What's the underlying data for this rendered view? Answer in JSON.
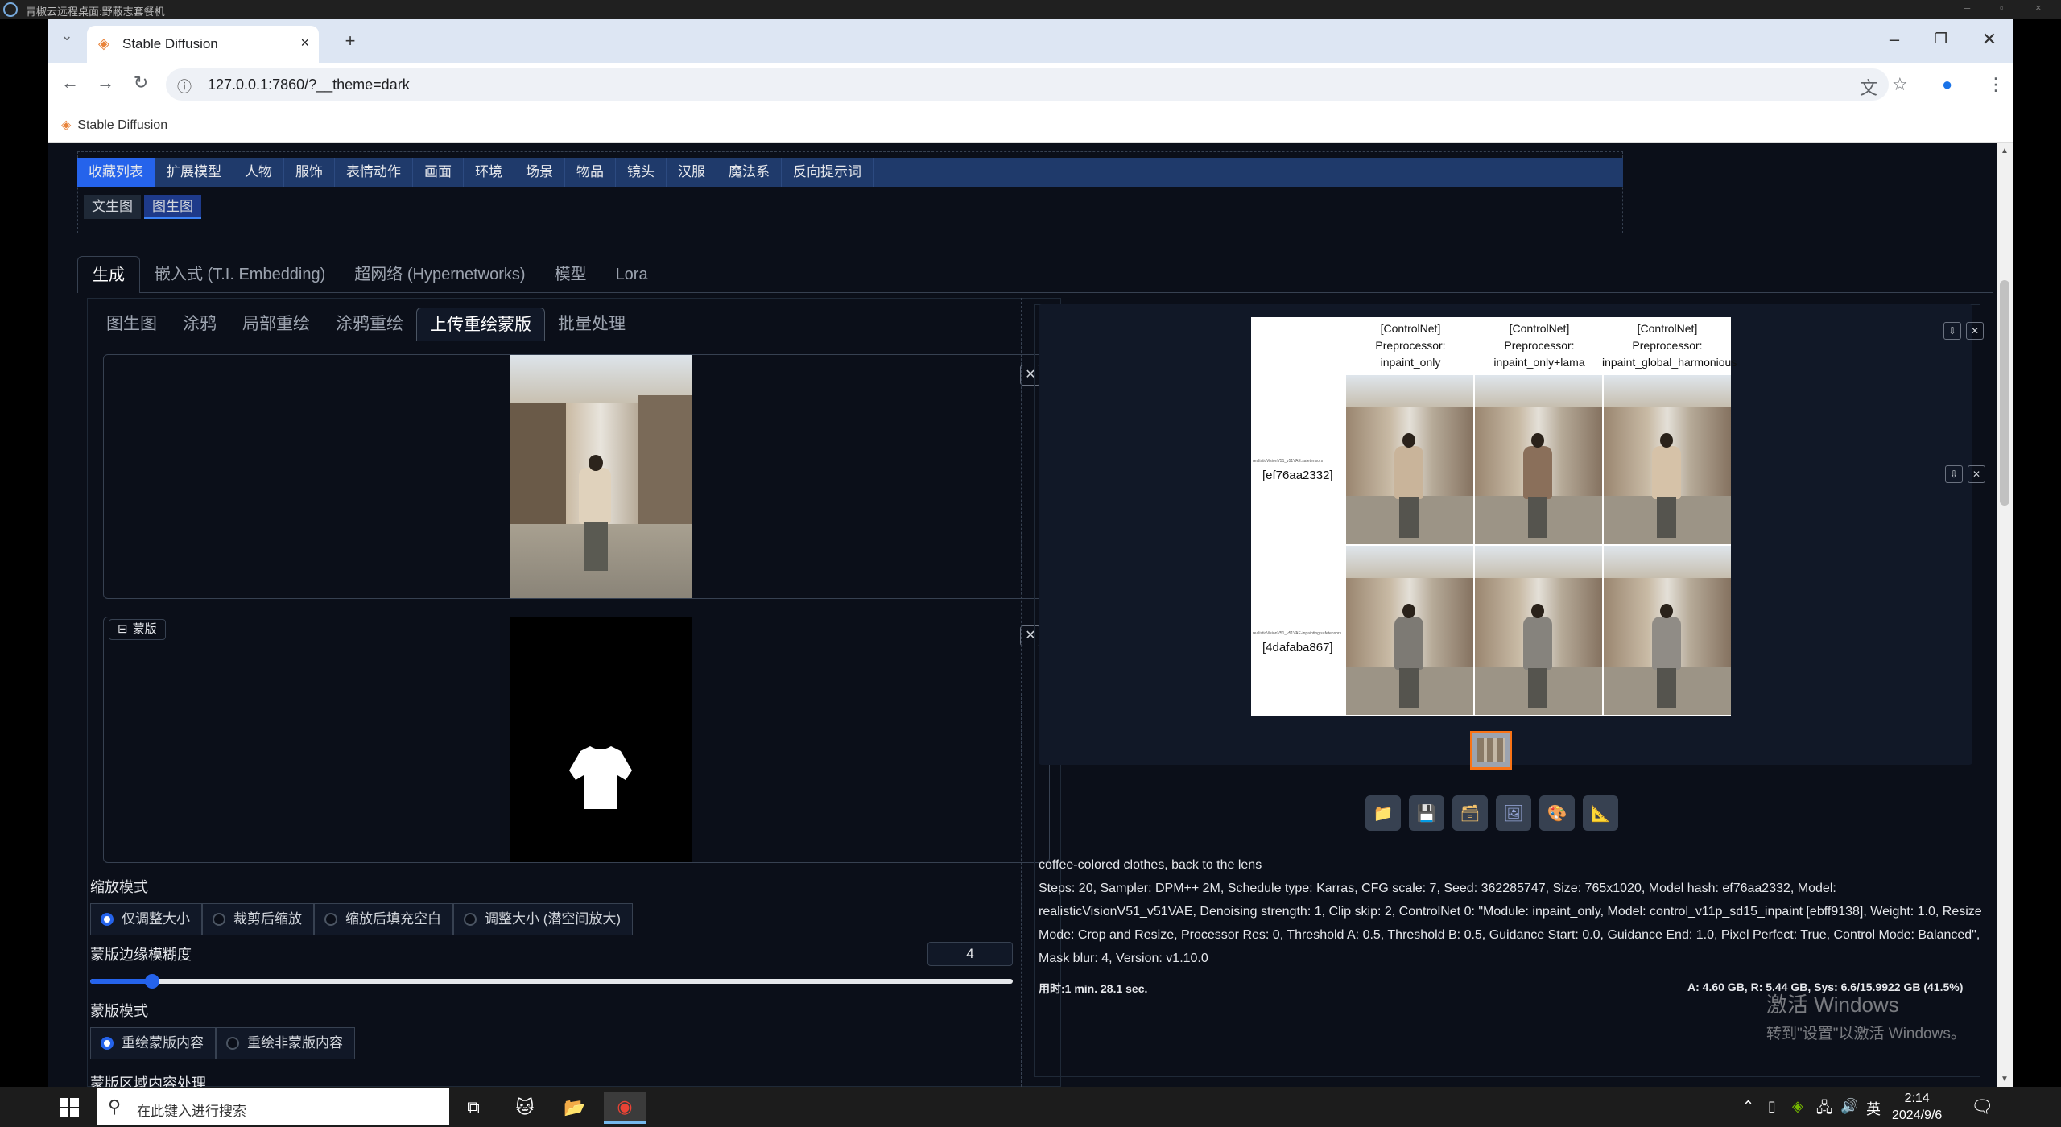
{
  "remote_desktop": {
    "title": "青椒云远程桌面:野蔽志套餐机"
  },
  "browser": {
    "tab_title": "Stable Diffusion",
    "url": "127.0.0.1:7860/?__theme=dark",
    "bookmark": "Stable Diffusion",
    "new_tab": "+",
    "tab_close": "×"
  },
  "favorites": {
    "tabs": [
      "收藏列表",
      "扩展模型",
      "人物",
      "服饰",
      "表情动作",
      "画面",
      "环境",
      "场景",
      "物品",
      "镜头",
      "汉服",
      "魔法系",
      "反向提示词"
    ],
    "subtabs": [
      "文生图",
      "图生图"
    ]
  },
  "main_tabs": [
    "生成",
    "嵌入式 (T.I. Embedding)",
    "超网络 (Hypernetworks)",
    "模型",
    "Lora"
  ],
  "img_tabs": [
    "图生图",
    "涂鸦",
    "局部重绘",
    "涂鸦重绘",
    "上传重绘蒙版",
    "批量处理"
  ],
  "mask_label": "蒙版",
  "resize_mode": {
    "label": "缩放模式",
    "options": [
      "仅调整大小",
      "裁剪后缩放",
      "缩放后填充空白",
      "调整大小 (潜空间放大)"
    ],
    "selected": 0
  },
  "mask_blur": {
    "label": "蒙版边缘模糊度",
    "value": "4",
    "min": 0,
    "max": 64
  },
  "mask_mode": {
    "label": "蒙版模式",
    "options": [
      "重绘蒙版内容",
      "重绘非蒙版内容"
    ],
    "selected": 0
  },
  "masked_content_label": "蒙版区域内容处理",
  "output": {
    "grid_headers": [
      "[ControlNet]\nPreprocessor:\ninpaint_only",
      "[ControlNet]\nPreprocessor:\ninpaint_only+lama",
      "[ControlNet]\nPreprocessor:\ninpaint_global_harmonious"
    ],
    "row_labels": [
      "[ef76aa2332]",
      "[4dafaba867]"
    ],
    "row_tiny_labels": [
      "realisticVisionV51_v51VAE.safetensors",
      "realisticVisionV51_v51VAE-inpainting.safetensors"
    ],
    "caption_prompt": "coffee-colored clothes, back to the lens",
    "caption_params": "Steps: 20, Sampler: DPM++ 2M, Schedule type: Karras, CFG scale: 7, Seed: 362285747, Size: 765x1020, Model hash: ef76aa2332, Model: realisticVisionV51_v51VAE, Denoising strength: 1, Clip skip: 2, ControlNet 0: \"Module: inpaint_only, Model: control_v11p_sd15_inpaint [ebff9138], Weight: 1.0, Resize Mode: Crop and Resize, Processor Res: 0, Threshold A: 0.5, Threshold B: 0.5, Guidance Start: 0.0, Guidance End: 1.0, Pixel Perfect: True, Control Mode: Balanced\", Mask blur: 4, Version: v1.10.0",
    "timing": "用时:1 min. 28.1 sec.",
    "vram": "A: 4.60 GB, R: 5.44 GB, Sys: 6.6/15.9922 GB (41.5%)"
  },
  "toolbar_icons": [
    "folder-icon",
    "save-icon",
    "zip-icon",
    "send-to-img2img-icon",
    "send-to-inpaint-icon",
    "send-to-extras-icon"
  ],
  "watermark": {
    "line1": "激活 Windows",
    "line2": "转到\"设置\"以激活 Windows。"
  },
  "taskbar": {
    "search_placeholder": "在此键入进行搜索",
    "time": "2:14",
    "date": "2024/9/6",
    "ime": "英"
  },
  "colors": {
    "accent": "#2563eb",
    "page_bg": "#0b0f19",
    "fav_bar": "#1f3a6b",
    "thumb_border": "#f97316"
  }
}
